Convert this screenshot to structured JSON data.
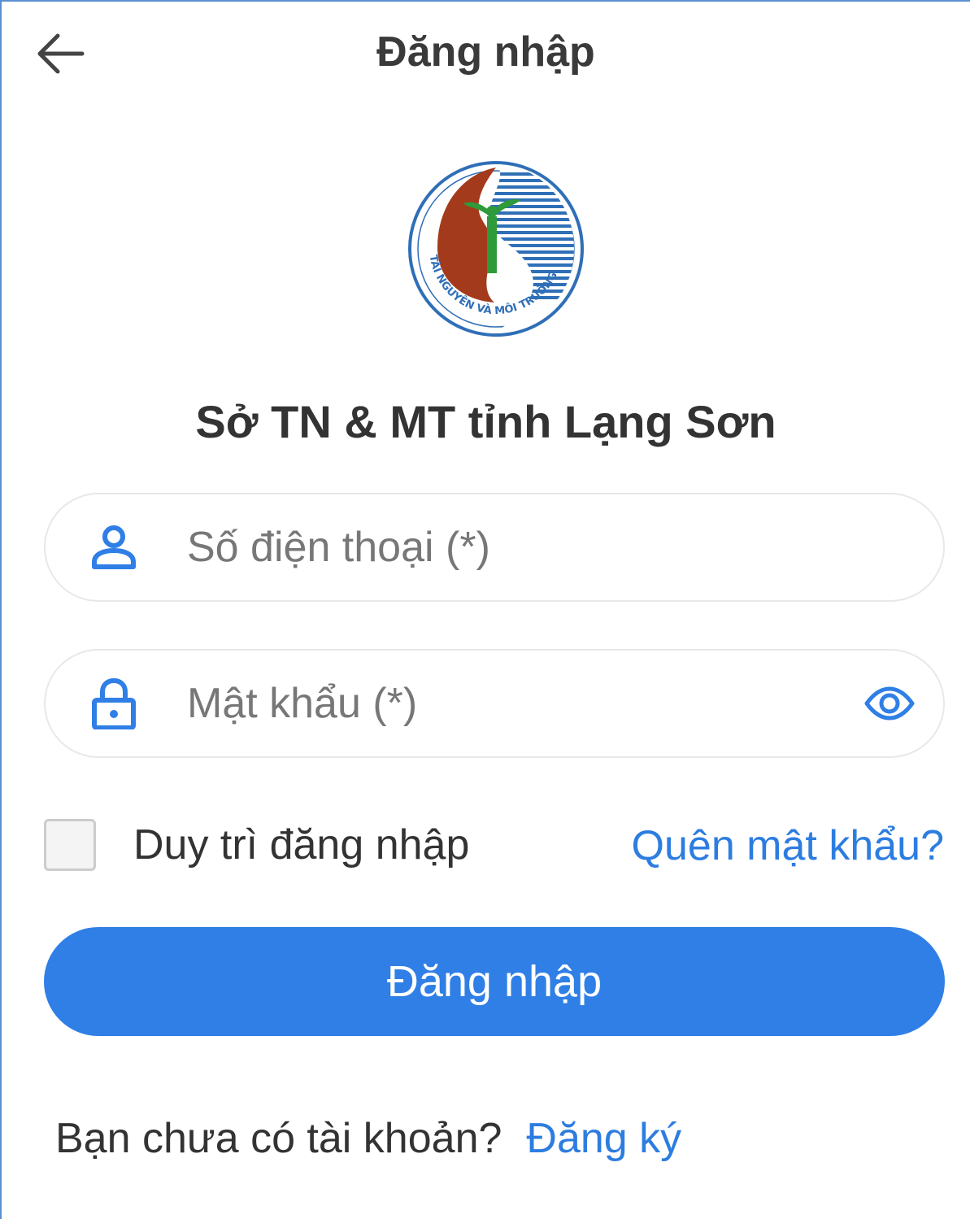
{
  "header": {
    "title": "Đăng nhập",
    "back_icon": "arrow-left-icon"
  },
  "logo": {
    "text": "TÀI NGUYÊN VÀ MÔI TRƯỜNG",
    "colors": {
      "red": "#a33a1c",
      "blue": "#2f6fb7",
      "green": "#2f9a3a"
    }
  },
  "org_name": "Sở TN & MT tỉnh Lạng Sơn",
  "form": {
    "phone": {
      "placeholder": "Số điện thoại (*)",
      "value": "",
      "icon": "user-icon"
    },
    "password": {
      "placeholder": "Mật khẩu (*)",
      "value": "",
      "icon": "lock-icon",
      "toggle_icon": "eye-icon"
    },
    "remember_label": "Duy trì đăng nhập",
    "remember_checked": false,
    "forgot_label": "Quên mật khẩu?",
    "submit_label": "Đăng nhập"
  },
  "signup": {
    "prompt": "Bạn chưa có tài khoản?",
    "link": "Đăng ký"
  },
  "colors": {
    "accent": "#2f7fe6",
    "link": "#2d7de0"
  }
}
